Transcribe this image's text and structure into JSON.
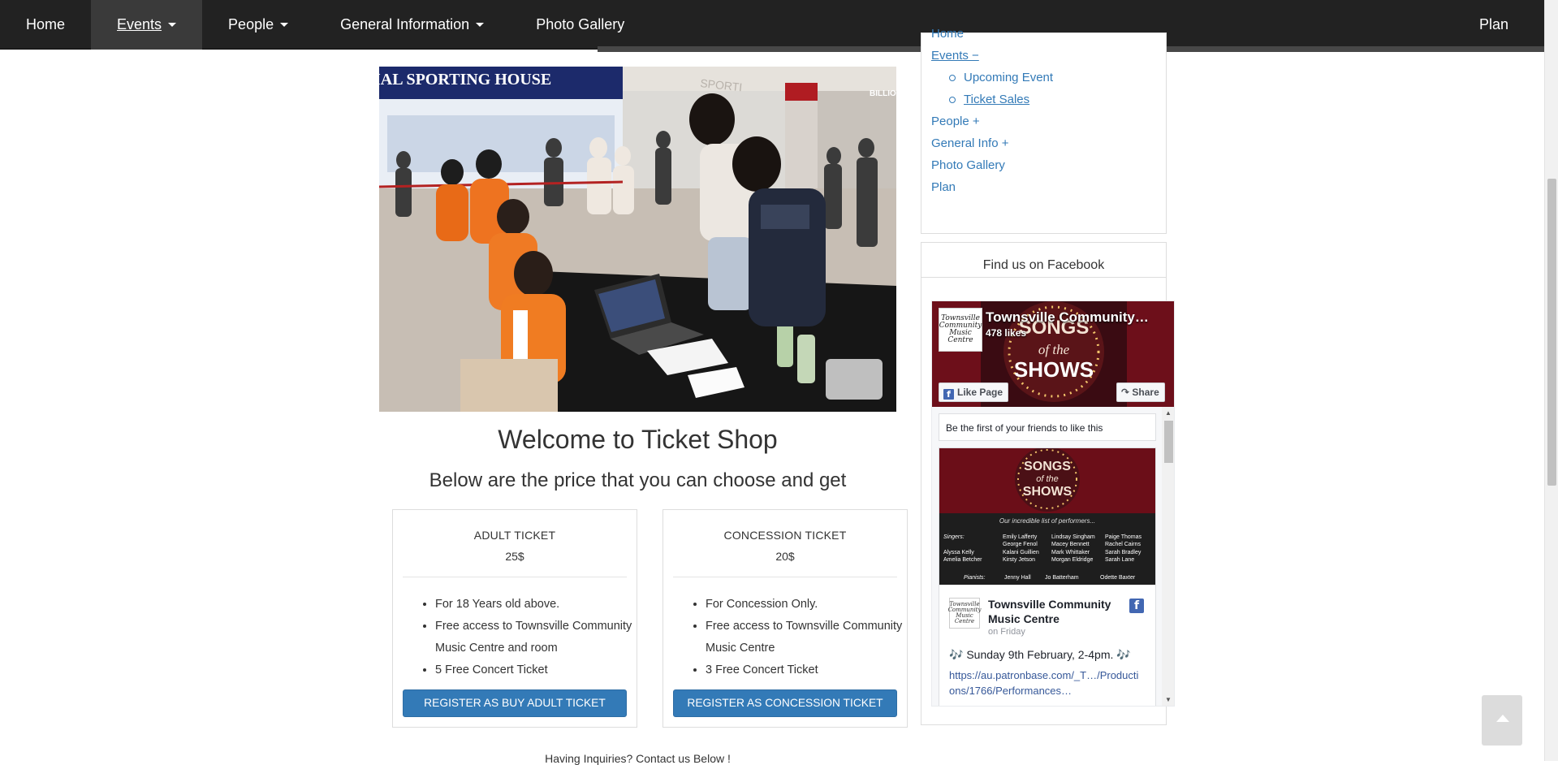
{
  "nav": {
    "items": [
      {
        "label": "Home",
        "dropdown": false
      },
      {
        "label": "Events",
        "dropdown": true,
        "active": true
      },
      {
        "label": "People",
        "dropdown": true
      },
      {
        "label": "General Information",
        "dropdown": true
      },
      {
        "label": "Photo Gallery",
        "dropdown": false
      }
    ],
    "right": "Plan"
  },
  "hero": {
    "sign_text": "IAL SPORTING HOUSE",
    "sign_text_2": "SPORTI",
    "store_sign": "BILLION"
  },
  "main": {
    "title": "Welcome to Ticket Shop",
    "subtitle": "Below are the price that you can choose and get",
    "tickets": [
      {
        "name": "ADULT TICKET",
        "price": "25$",
        "features": [
          "For 18 Years old above.",
          "Free access to Townsville Community Music Centre and room",
          "5 Free Concert Ticket"
        ],
        "button": "REGISTER AS BUY ADULT TICKET"
      },
      {
        "name": "CONCESSION TICKET",
        "price": "20$",
        "features": [
          "For Concession Only.",
          "Free access to Townsville Community Music Centre",
          "3 Free Concert Ticket"
        ],
        "button": "REGISTER AS CONCESSION TICKET"
      }
    ],
    "inquiries": "Having Inquiries? Contact us Below !"
  },
  "sidebar": {
    "menu": {
      "items": [
        {
          "label": "Home"
        },
        {
          "label": "Events −"
        },
        {
          "label": "Upcoming Event",
          "sub": true
        },
        {
          "label": "Ticket Sales",
          "sub": true,
          "underline": true
        },
        {
          "label": "People +"
        },
        {
          "label": "General Info +"
        },
        {
          "label": "Photo Gallery"
        },
        {
          "label": "Plan"
        }
      ]
    },
    "facebook": {
      "heading": "Find us on Facebook",
      "page_name": "Townsville Community…",
      "likes": "478 likes",
      "logo_text": "Townsville Community Music Centre",
      "cover_text": [
        "SONGS",
        "of the",
        "SHOWS"
      ],
      "like_button": "Like Page",
      "share_button": "Share",
      "friends_text": "Be the first of your friends to like this",
      "post": {
        "poster_title": [
          "SONGS",
          "of the",
          "SHOWS"
        ],
        "poster_subtitle": "Our incredible list of performers...",
        "singers_label": "Singers:",
        "singers_col1": [
          "Alyssa Kelly",
          "Amelia Betcher"
        ],
        "singers_col2": [
          "Emily Lafferty",
          "George Fenol",
          "Kalani Guillien",
          "Kirsty Jetson"
        ],
        "singers_col3": [
          "Lindsay Singham",
          "Macey Bennett",
          "Mark Whittaker",
          "Morgan Eldridge"
        ],
        "singers_col4": [
          "Paige Thomas",
          "Rachel Cairns",
          "Sarah Bradley",
          "Sarah Lane"
        ],
        "pianists_label": "Pianists:",
        "pianists": [
          "Jenny Hall",
          "Jo Batterham",
          "Odette Baxter"
        ],
        "author": "Townsville Community Music Centre",
        "time": "on Friday",
        "text": "🎶 Sunday 9th February, 2-4pm. 🎶",
        "link": "https://au.patronbase.com/_T…/Productions/1766/Performances…"
      }
    }
  },
  "colors": {
    "navbar": "#222222",
    "link": "#337ab7",
    "button": "#337ab7",
    "facebook": "#4267b2"
  }
}
